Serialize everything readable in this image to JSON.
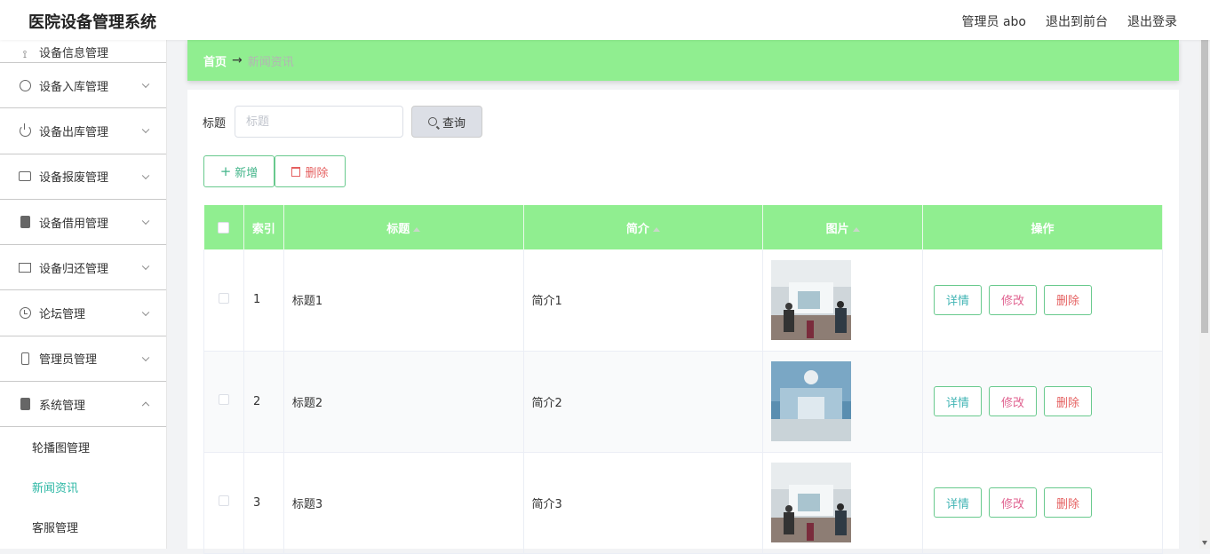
{
  "header": {
    "title": "医院设备管理系统",
    "user": "管理员 abo",
    "to_front": "退出到前台",
    "logout": "退出登录"
  },
  "sidebar": {
    "items": [
      {
        "label": "设备信息管理",
        "icon": "equipment-info-icon"
      },
      {
        "label": "设备入库管理",
        "icon": "inbound-icon"
      },
      {
        "label": "设备出库管理",
        "icon": "outbound-icon"
      },
      {
        "label": "设备报废管理",
        "icon": "scrap-icon"
      },
      {
        "label": "设备借用管理",
        "icon": "borrow-icon"
      },
      {
        "label": "设备归还管理",
        "icon": "return-icon"
      },
      {
        "label": "论坛管理",
        "icon": "forum-icon"
      },
      {
        "label": "管理员管理",
        "icon": "admin-icon"
      },
      {
        "label": "系统管理",
        "icon": "system-icon"
      }
    ],
    "submenu": [
      {
        "label": "轮播图管理"
      },
      {
        "label": "新闻资讯",
        "active": true
      },
      {
        "label": "客服管理"
      }
    ]
  },
  "breadcrumb": {
    "home": "首页",
    "separator": "→",
    "current": "新闻资讯"
  },
  "search": {
    "label": "标题",
    "placeholder": "标题",
    "value": "",
    "button": "查询"
  },
  "actions": {
    "add": "新增",
    "delete": "删除"
  },
  "table": {
    "columns": [
      "索引",
      "标题",
      "简介",
      "图片",
      "操作"
    ],
    "rows": [
      {
        "index": "1",
        "title": "标题1",
        "intro": "简介1"
      },
      {
        "index": "2",
        "title": "标题2",
        "intro": "简介2"
      },
      {
        "index": "3",
        "title": "标题3",
        "intro": "简介3"
      }
    ],
    "ops": {
      "detail": "详情",
      "edit": "修改",
      "delete": "删除"
    }
  },
  "colors": {
    "accent_green": "#90ee90",
    "active_teal": "#2bb7a4",
    "danger_red": "#e56060",
    "edit_pink": "#e0618f"
  }
}
